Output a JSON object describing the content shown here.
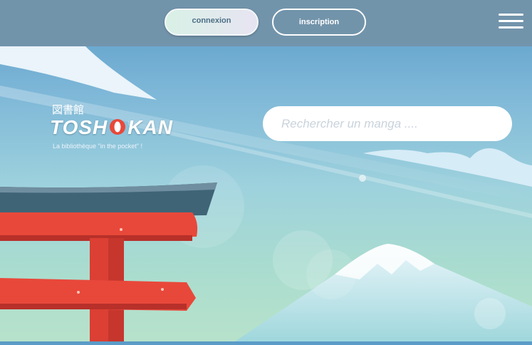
{
  "header": {
    "login_label": "connexion",
    "signup_label": "inscription",
    "menu_icon": "hamburger-menu-icon"
  },
  "brand": {
    "japanese": "図書館",
    "name_before": "TOSH",
    "name_after": "KAN",
    "tagline": "La bibliothèque \"in the pocket\" !"
  },
  "search": {
    "placeholder": "Rechercher un manga ...."
  },
  "colors": {
    "topbar": "#7294ab",
    "accent_red": "#e8483a",
    "sky": "#7fb8d8"
  }
}
